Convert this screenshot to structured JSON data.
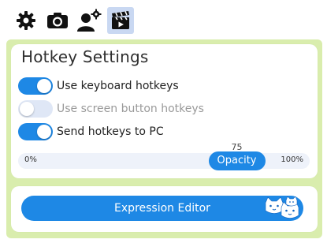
{
  "toolbar": {
    "icons": [
      "gear-icon",
      "camera-icon",
      "user-settings-icon",
      "clapperboard-icon"
    ],
    "active_icon": "clapperboard-icon"
  },
  "hotkeys": {
    "title": "Hotkey Settings",
    "options": [
      {
        "label": "Use keyboard hotkeys",
        "enabled": true
      },
      {
        "label": "Use screen button hotkeys",
        "enabled": false
      },
      {
        "label": "Send hotkeys to PC",
        "enabled": true
      }
    ],
    "opacity": {
      "label": "Opacity",
      "value": "75",
      "min_label": "0%",
      "max_label": "100%",
      "fraction": 0.75
    }
  },
  "expression_editor": {
    "label": "Expression Editor",
    "icon": "cat-faces-icon"
  },
  "colors": {
    "accent": "#1e88e5",
    "panel_background": "#d9edad",
    "toggle_off": "#dfe7f6",
    "active_tab": "#c9d8f2"
  }
}
